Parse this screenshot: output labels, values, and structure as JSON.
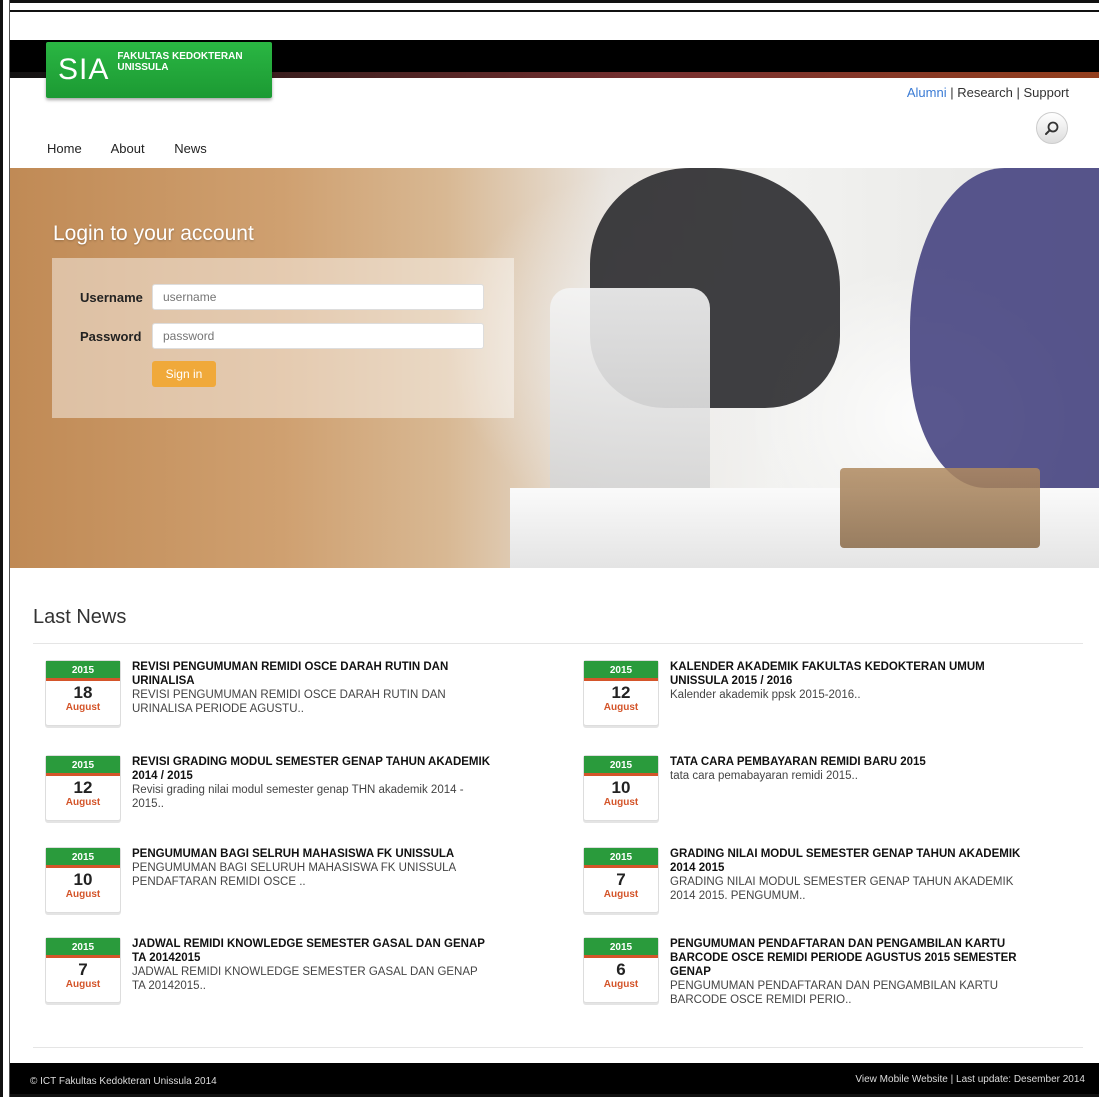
{
  "header": {
    "logo_main": "SIA",
    "logo_sub_1": "FAKULTAS KEDOKTERAN",
    "logo_sub_2": "UNISSULA",
    "links": [
      "Alumni",
      "Research",
      "Support"
    ],
    "separator": " | "
  },
  "nav": {
    "items": [
      "Home",
      "About",
      "News"
    ]
  },
  "login": {
    "title": "Login to your account",
    "username_label": "Username",
    "username_placeholder": "username",
    "password_label": "Password",
    "password_placeholder": "password",
    "signin_label": "Sign in"
  },
  "news": {
    "section_title": "Last News",
    "items": [
      {
        "year": "2015",
        "day": "18",
        "month": "August",
        "title": "REVISI PENGUMUMAN REMIDI OSCE DARAH RUTIN DAN URINALISA",
        "summary": "REVISI PENGUMUMAN REMIDI OSCE DARAH RUTIN DAN URINALISA PERIODE AGUSTU.."
      },
      {
        "year": "2015",
        "day": "12",
        "month": "August",
        "title": "KALENDER AKADEMIK FAKULTAS KEDOKTERAN UMUM UNISSULA 2015 / 2016",
        "summary": "Kalender akademik ppsk 2015-2016.."
      },
      {
        "year": "2015",
        "day": "12",
        "month": "August",
        "title": "REVISI GRADING MODUL SEMESTER GENAP TAHUN AKADEMIK 2014 / 2015",
        "summary": "Revisi grading nilai modul semester genap THN akademik 2014 - 2015.."
      },
      {
        "year": "2015",
        "day": "10",
        "month": "August",
        "title": "TATA CARA PEMBAYARAN REMIDI BARU 2015",
        "summary": "tata cara pemabayaran remidi 2015.."
      },
      {
        "year": "2015",
        "day": "10",
        "month": "August",
        "title": "PENGUMUMAN BAGI SELRUH MAHASISWA FK UNISSULA",
        "summary": "PENGUMUMAN BAGI SELURUH MAHASISWA FK UNISSULA PENDAFTARAN REMIDI OSCE .."
      },
      {
        "year": "2015",
        "day": "7",
        "month": "August",
        "title": "GRADING NILAI MODUL SEMESTER GENAP TAHUN AKADEMIK 2014 2015",
        "summary": "GRADING NILAI MODUL SEMESTER GENAP TAHUN AKADEMIK 2014 2015. PENGUMUM.."
      },
      {
        "year": "2015",
        "day": "7",
        "month": "August",
        "title": "JADWAL REMIDI KNOWLEDGE SEMESTER GASAL DAN GENAP TA 20142015",
        "summary": "JADWAL REMIDI KNOWLEDGE SEMESTER GASAL DAN GENAP TA 20142015.."
      },
      {
        "year": "2015",
        "day": "6",
        "month": "August",
        "title": "PENGUMUMAN PENDAFTARAN DAN PENGAMBILAN KARTU BARCODE OSCE REMIDI PERIODE AGUSTUS 2015 SEMESTER GENAP",
        "summary": "PENGUMUMAN PENDAFTARAN DAN PENGAMBILAN KARTU BARCODE OSCE REMIDI PERIO.."
      }
    ]
  },
  "footer": {
    "left": "© ICT Fakultas Kedokteran Unissula 2014",
    "right": "View Mobile Website | Last update: Desember 2014"
  },
  "icons": {
    "search": "search-icon"
  },
  "colors": {
    "green": "#2a9b3c",
    "orange": "#d4552a",
    "signin": "#f0a93a",
    "link": "#3a7bd5"
  }
}
